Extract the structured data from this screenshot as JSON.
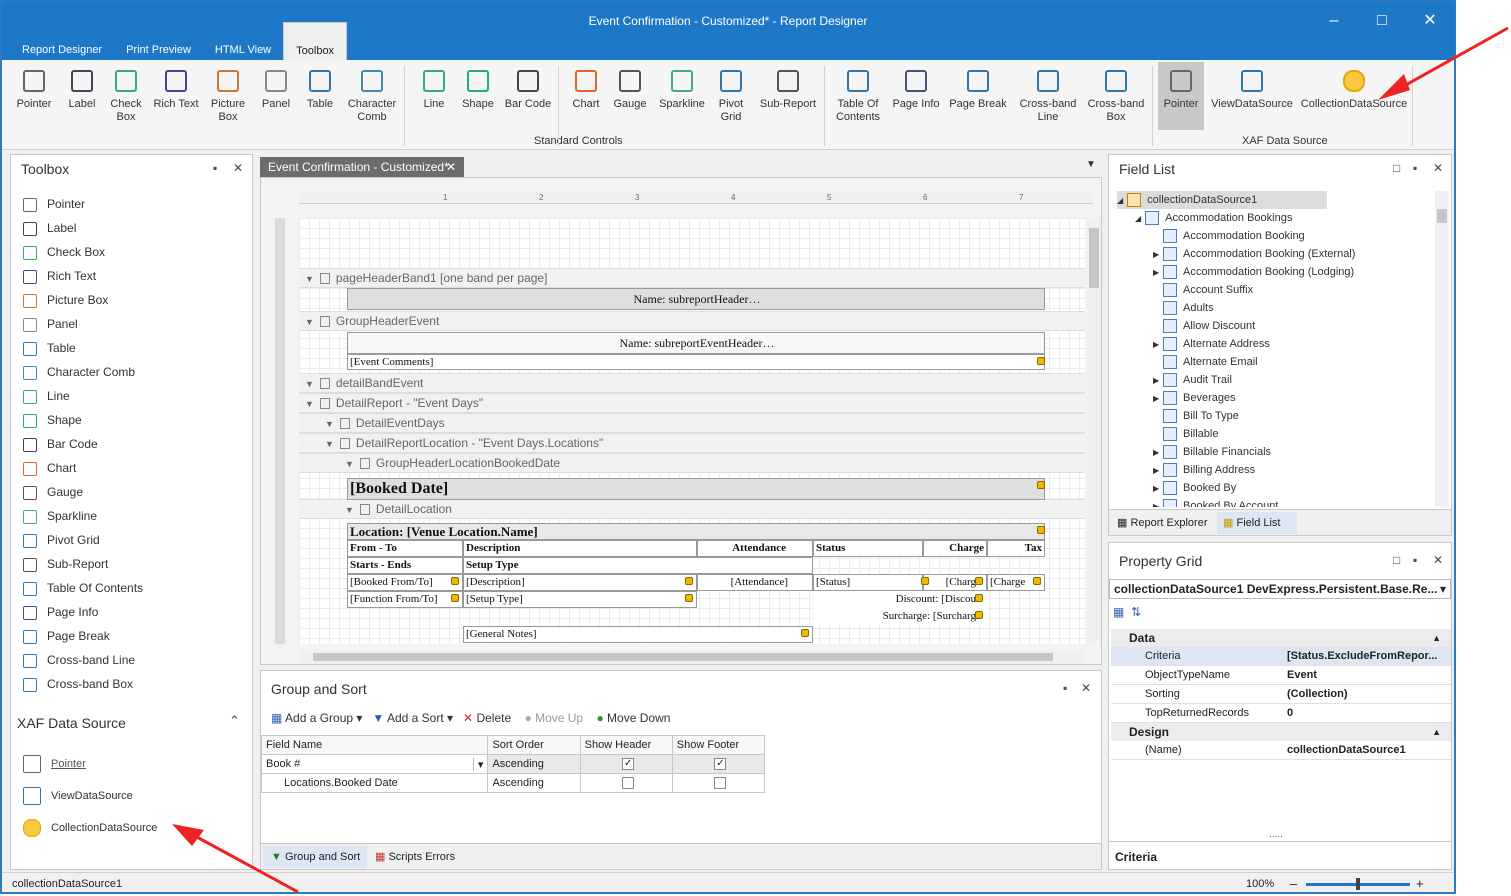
{
  "window": {
    "title": "Event Confirmation - Customized* - Report Designer"
  },
  "ribbon_tabs": [
    "Report Designer",
    "Print Preview",
    "HTML View",
    "Toolbox"
  ],
  "ribbon": {
    "standard_controls": [
      "Pointer",
      "Label",
      "Check\nBox",
      "Rich Text",
      "Picture\nBox",
      "Panel",
      "Table",
      "Character\nComb",
      "Line",
      "Shape",
      "Bar Code",
      "Chart",
      "Gauge",
      "Sparkline",
      "Pivot\nGrid",
      "Sub-Report",
      "Table Of\nContents",
      "Page Info",
      "Page Break",
      "Cross-band\nLine",
      "Cross-band\nBox"
    ],
    "standard_group": "Standard Controls",
    "xaf_controls": [
      "Pointer",
      "ViewDataSource",
      "CollectionDataSource"
    ],
    "xaf_group": "XAF Data Source"
  },
  "toolbox": {
    "title": "Toolbox",
    "items": [
      "Pointer",
      "Label",
      "Check Box",
      "Rich Text",
      "Picture Box",
      "Panel",
      "Table",
      "Character Comb",
      "Line",
      "Shape",
      "Bar Code",
      "Chart",
      "Gauge",
      "Sparkline",
      "Pivot Grid",
      "Sub-Report",
      "Table Of Contents",
      "Page Info",
      "Page Break",
      "Cross-band Line",
      "Cross-band Box"
    ],
    "xaf_title": "XAF Data Source",
    "xaf_items": [
      "Pointer",
      "ViewDataSource",
      "CollectionDataSource"
    ]
  },
  "document_tab": "Event Confirmation - Customized*",
  "bands": [
    "pageHeaderBand1 [one band per page]",
    "GroupHeaderEvent",
    "detailBandEvent",
    "DetailReport - \"Event Days\"",
    "DetailEventDays",
    "DetailReportLocation - \"Event Days.Locations\"",
    "GroupHeaderLocationBookedDate",
    "DetailLocation"
  ],
  "controls": {
    "subreport_header": "Name: subreportHeader…",
    "subreport_event_header": "Name: subreportEventHeader…",
    "event_comments": "[Event Comments]",
    "booked_date": "[Booked Date]",
    "location": "Location: [Venue Location.Name]",
    "col_from_to": "From - To",
    "col_description": "Description",
    "col_attendance": "Attendance",
    "col_status": "Status",
    "col_charge": "Charge",
    "col_tax": "Tax",
    "col_starts_ends": "Starts - Ends",
    "col_setup_type": "Setup Type",
    "f_booked_from_to": "[Booked From/To]",
    "f_description": "[Description]",
    "f_attendance": "[Attendance]",
    "f_status": "[Status]",
    "f_charge1": "[Charg",
    "f_charge2": "[Charge",
    "f_function_from_to": "[Function From/To]",
    "f_setup_type": "[Setup Type]",
    "f_discount": "Discount: [Discou",
    "f_surcharge": "Surcharge: [Surcharg",
    "f_general_notes": "[General Notes]"
  },
  "ruler_marks": [
    "1",
    "2",
    "3",
    "4",
    "5",
    "6",
    "7"
  ],
  "group_sort": {
    "title": "Group and Sort",
    "toolbar": [
      "Add a Group",
      "Add a Sort",
      "Delete",
      "Move Up",
      "Move Down"
    ],
    "headers": [
      "Field Name",
      "Sort Order",
      "Show Header",
      "Show Footer"
    ],
    "rows": [
      {
        "field": "Book #",
        "order": "Ascending",
        "header": true,
        "footer": true
      },
      {
        "field": "Locations.Booked Date",
        "order": "Ascending",
        "header": false,
        "footer": false
      }
    ],
    "bottom_tabs": [
      "Group and Sort",
      "Scripts Errors"
    ]
  },
  "field_list": {
    "title": "Field List",
    "root": "collectionDataSource1",
    "child": "Accommodation Bookings",
    "items": [
      "Accommodation Booking",
      "Accommodation Booking (External)",
      "Accommodation Booking (Lodging)",
      "Account Suffix",
      "Adults",
      "Allow Discount",
      "Alternate Address",
      "Alternate Email",
      "Audit Trail",
      "Beverages",
      "Bill To Type",
      "Billable",
      "Billable Financials",
      "Billing Address",
      "Booked By",
      "Booked By Account"
    ],
    "tabs": [
      "Report Explorer",
      "Field List"
    ]
  },
  "property_grid": {
    "title": "Property Grid",
    "selector": "collectionDataSource1   DevExpress.Persistent.Base.Re...",
    "cat_data": "Data",
    "data_rows": [
      {
        "k": "Criteria",
        "v": "[Status.ExcludeFromRepor..."
      },
      {
        "k": "ObjectTypeName",
        "v": "Event"
      },
      {
        "k": "Sorting",
        "v": "(Collection)"
      },
      {
        "k": "TopReturnedRecords",
        "v": "0"
      }
    ],
    "cat_design": "Design",
    "design_rows": [
      {
        "k": "(Name)",
        "v": "collectionDataSource1"
      }
    ],
    "description": "Criteria"
  },
  "status": {
    "left": "collectionDataSource1",
    "zoom": "100%"
  }
}
